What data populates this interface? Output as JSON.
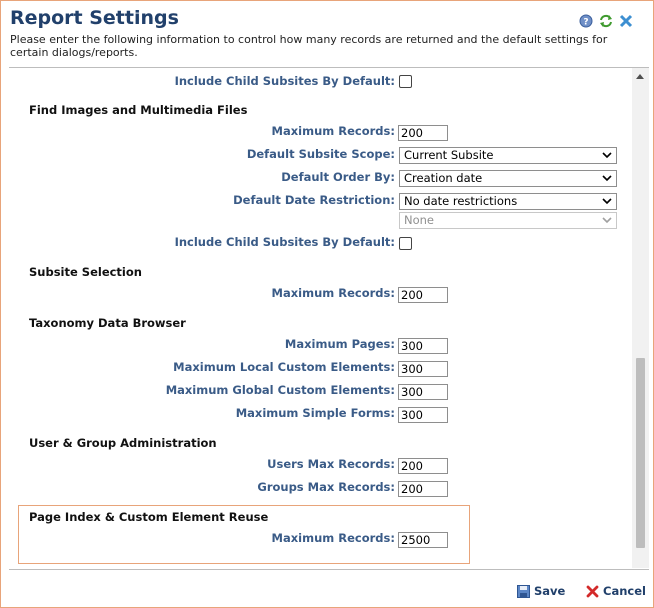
{
  "header": {
    "title": "Report Settings",
    "description": "Please enter the following information to control how many records are returned and the default settings for certain dialogs/reports.",
    "icons": [
      "help-icon",
      "refresh-icon",
      "close-icon"
    ]
  },
  "form": {
    "top_include_child": {
      "label": "Include Child Subsites By Default:",
      "checked": false
    },
    "find_images": {
      "heading": "Find Images and Multimedia Files",
      "max_records_label": "Maximum Records:",
      "max_records_value": "200",
      "scope_label": "Default Subsite Scope:",
      "scope_value": "Current Subsite",
      "order_label": "Default Order By:",
      "order_value": "Creation date",
      "date_label": "Default Date Restriction:",
      "date_value": "No date restrictions",
      "date_sub_value": "None",
      "include_child_label": "Include Child Subsites By Default:",
      "include_child_checked": false
    },
    "subsite_selection": {
      "heading": "Subsite Selection",
      "max_records_label": "Maximum Records:",
      "max_records_value": "200"
    },
    "taxonomy": {
      "heading": "Taxonomy Data Browser",
      "max_pages_label": "Maximum Pages:",
      "max_pages_value": "300",
      "local_label": "Maximum Local Custom Elements:",
      "local_value": "300",
      "global_label": "Maximum Global Custom Elements:",
      "global_value": "300",
      "simple_forms_label": "Maximum Simple Forms:",
      "simple_forms_value": "300"
    },
    "user_group": {
      "heading": "User & Group Administration",
      "users_label": "Users Max Records:",
      "users_value": "200",
      "groups_label": "Groups Max Records:",
      "groups_value": "200"
    },
    "page_index": {
      "heading": "Page Index & Custom Element Reuse",
      "max_records_label": "Maximum Records:",
      "max_records_value": "2500"
    }
  },
  "footer": {
    "save_label": "Save",
    "cancel_label": "Cancel"
  },
  "colors": {
    "title": "#21406b",
    "label": "#3a5b87",
    "highlight_border": "#e8a47a"
  }
}
